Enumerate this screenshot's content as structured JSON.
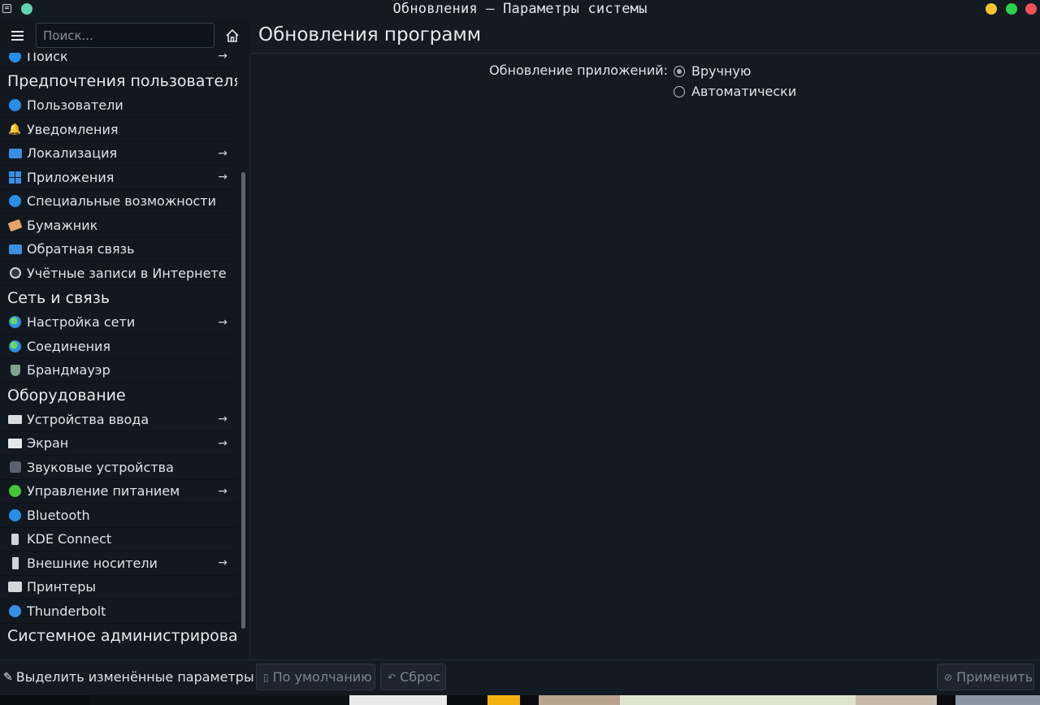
{
  "window": {
    "title": "Обновления — Параметры системы",
    "colors": {
      "minimize": "#f7c32e",
      "maximize": "#2bd14a",
      "close": "#f0525a",
      "pin": "#5fd3b8"
    }
  },
  "search": {
    "placeholder": "Поиск..."
  },
  "sidebar": {
    "partial_item": {
      "label": "Поиск",
      "icon": "search-icon",
      "arrow": true
    },
    "sections": [
      {
        "title": "Предпочтения пользователя",
        "items": [
          {
            "label": "Пользователи",
            "icon": "users-icon",
            "arrow": false
          },
          {
            "label": "Уведомления",
            "icon": "bell-icon",
            "arrow": false
          },
          {
            "label": "Локализация",
            "icon": "localization-icon",
            "arrow": true
          },
          {
            "label": "Приложения",
            "icon": "applications-icon",
            "arrow": true
          },
          {
            "label": "Специальные возможности",
            "icon": "accessibility-icon",
            "arrow": false
          },
          {
            "label": "Бумажник",
            "icon": "wallet-icon",
            "arrow": false
          },
          {
            "label": "Обратная связь",
            "icon": "feedback-icon",
            "arrow": false
          },
          {
            "label": "Учётные записи в Интернете",
            "icon": "online-accounts-icon",
            "arrow": false
          }
        ]
      },
      {
        "title": "Сеть и связь",
        "items": [
          {
            "label": "Настройка сети",
            "icon": "network-icon",
            "arrow": true
          },
          {
            "label": "Соединения",
            "icon": "connections-icon",
            "arrow": false
          },
          {
            "label": "Брандмауэр",
            "icon": "firewall-icon",
            "arrow": false
          }
        ]
      },
      {
        "title": "Оборудование",
        "items": [
          {
            "label": "Устройства ввода",
            "icon": "input-devices-icon",
            "arrow": true
          },
          {
            "label": "Экран",
            "icon": "display-icon",
            "arrow": true
          },
          {
            "label": "Звуковые устройства",
            "icon": "audio-icon",
            "arrow": false
          },
          {
            "label": "Управление питанием",
            "icon": "power-icon",
            "arrow": true
          },
          {
            "label": "Bluetooth",
            "icon": "bluetooth-icon",
            "arrow": false
          },
          {
            "label": "KDE Connect",
            "icon": "kde-connect-icon",
            "arrow": false
          },
          {
            "label": "Внешние носители",
            "icon": "removable-storage-icon",
            "arrow": true
          },
          {
            "label": "Принтеры",
            "icon": "printer-icon",
            "arrow": false
          },
          {
            "label": "Thunderbolt",
            "icon": "thunderbolt-icon",
            "arrow": false
          }
        ]
      },
      {
        "title": "Системное администрирован",
        "items": []
      }
    ]
  },
  "main": {
    "title": "Обновления программ",
    "option_label": "Обновление приложений:",
    "options": [
      {
        "label": "Вручную",
        "selected": true
      },
      {
        "label": "Автоматически",
        "selected": false
      }
    ]
  },
  "footer": {
    "highlight_label": "Выделить изменённые параметры",
    "default_label": "По умолчанию",
    "reset_label": "Сброс",
    "apply_label": "Применить"
  }
}
